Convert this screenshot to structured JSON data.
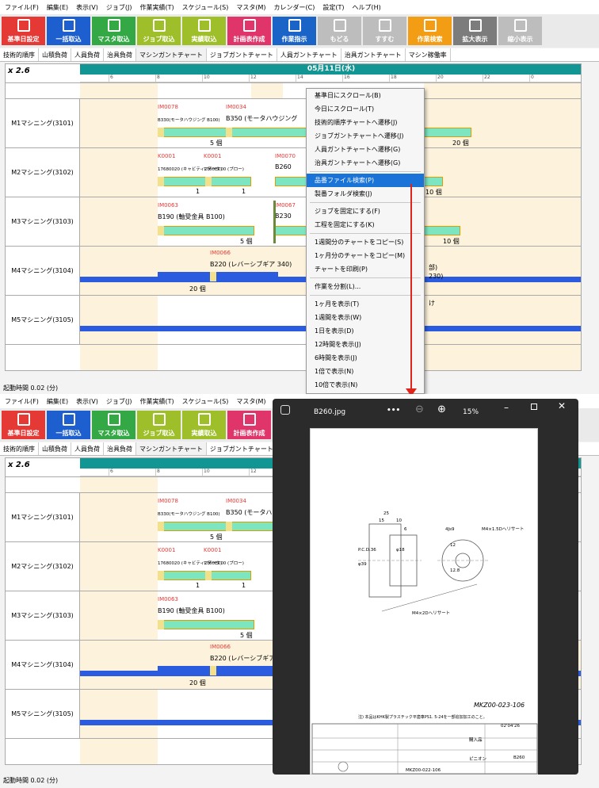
{
  "menu": [
    "ファイル(F)",
    "編集(E)",
    "表示(V)",
    "ジョブ(J)",
    "作業実績(T)",
    "スケジュール(S)",
    "マスタ(M)",
    "カレンダー(C)",
    "設定(T)",
    "ヘルプ(H)"
  ],
  "toolbar": [
    "基準日設定",
    "一括取込",
    "マスタ取込",
    "ジョブ取込",
    "実績取込",
    "計画表作成",
    "作業指示",
    "もどる",
    "すすむ",
    "作業検索",
    "拡大表示",
    "縮小表示"
  ],
  "tabs": [
    "技術的順序",
    "山積負荷",
    "人員負荷",
    "治具負荷",
    "マシンガントチャート",
    "ジョブガントチャート",
    "人員ガントチャート",
    "治具ガントチャート",
    "マシン稼働率"
  ],
  "scale": "x 2.6",
  "date": "05月11日(水)",
  "ticks": [
    "6",
    "8",
    "10",
    "12",
    "14",
    "16",
    "18",
    "20",
    "22",
    "0"
  ],
  "machines": [
    "M1マシニング(3101)",
    "M2マシニング(3102)",
    "M3マシニング(3103)",
    "M4マシニング(3104)",
    "M5マシニング(3105)"
  ],
  "jobs": {
    "m1": {
      "id1": "IM0078",
      "id2": "IM0034",
      "t1": "B330(モータハウジング B100)",
      "t2": "B350 (モータハウジング",
      "q1": "5 個",
      "q2": "20 個"
    },
    "m2": {
      "id1": "K0001",
      "id2": "K0001",
      "id3": "IM0070",
      "t1": "17680020 (キャビティ2データ)",
      "t2": "1760EC00 (ブロー)",
      "t3": "B260",
      "q1": "1",
      "q2": "1",
      "q3": "10 個"
    },
    "m3": {
      "id1": "IM0063",
      "id2": "IM0067",
      "t1": "B190 (軸受金具 B100)",
      "t2": "B230",
      "q1": "5 個",
      "q2": "10 個"
    },
    "m4": {
      "id1": "IM0066",
      "t1": "B220 (レバーシブギア 340)",
      "q1": "20 個",
      "p1": "部)",
      "p2": "230)"
    },
    "m5": {
      "p1": "け"
    }
  },
  "status": "起動時間 0.02 (分)",
  "context_menu": [
    "基準日にスクロール(B)",
    "今日にスクロール(T)",
    "技術的順序チャートへ遷移(J)",
    "ジョブガントチャートへ遷移(J)",
    "人員ガントチャートへ遷移(G)",
    "治具ガントチャートへ遷移(G)",
    "品番ファイル検索(P)",
    "製番フォルダ検索(J)",
    "ジョブを固定にする(F)",
    "工程を固定にする(K)",
    "1週間分のチャートをコピー(S)",
    "1ヶ月分のチャートをコピー(M)",
    "チャートを印刷(P)",
    "作業を分割(L)...",
    "1ヶ月を表示(T)",
    "1週間を表示(W)",
    "1日を表示(D)",
    "12時間を表示(J)",
    "6時間を表示(J)",
    "1倍で表示(N)",
    "10倍で表示(N)"
  ],
  "viewer": {
    "filename": "B260.jpg",
    "more": "•••",
    "zoom": "15%"
  },
  "drawing": {
    "dims": [
      "25",
      "15",
      "10",
      "6",
      "4Js9",
      "M4×1.5Dヘリサート",
      "M4×2Dヘリサート",
      "φ39",
      "P.C.D.36",
      "φ18",
      "12",
      "12.8"
    ],
    "note": "注) 本品はKHK製プラスチック平歯車PS1. 5-24を一部追加加工のこと。",
    "title_no": "MKZ00-023-106",
    "date": "02'04'26",
    "part": "ピニオン",
    "code": "B260",
    "purchased": "購入品",
    "bottom_no": "MKZ00-022-106"
  }
}
